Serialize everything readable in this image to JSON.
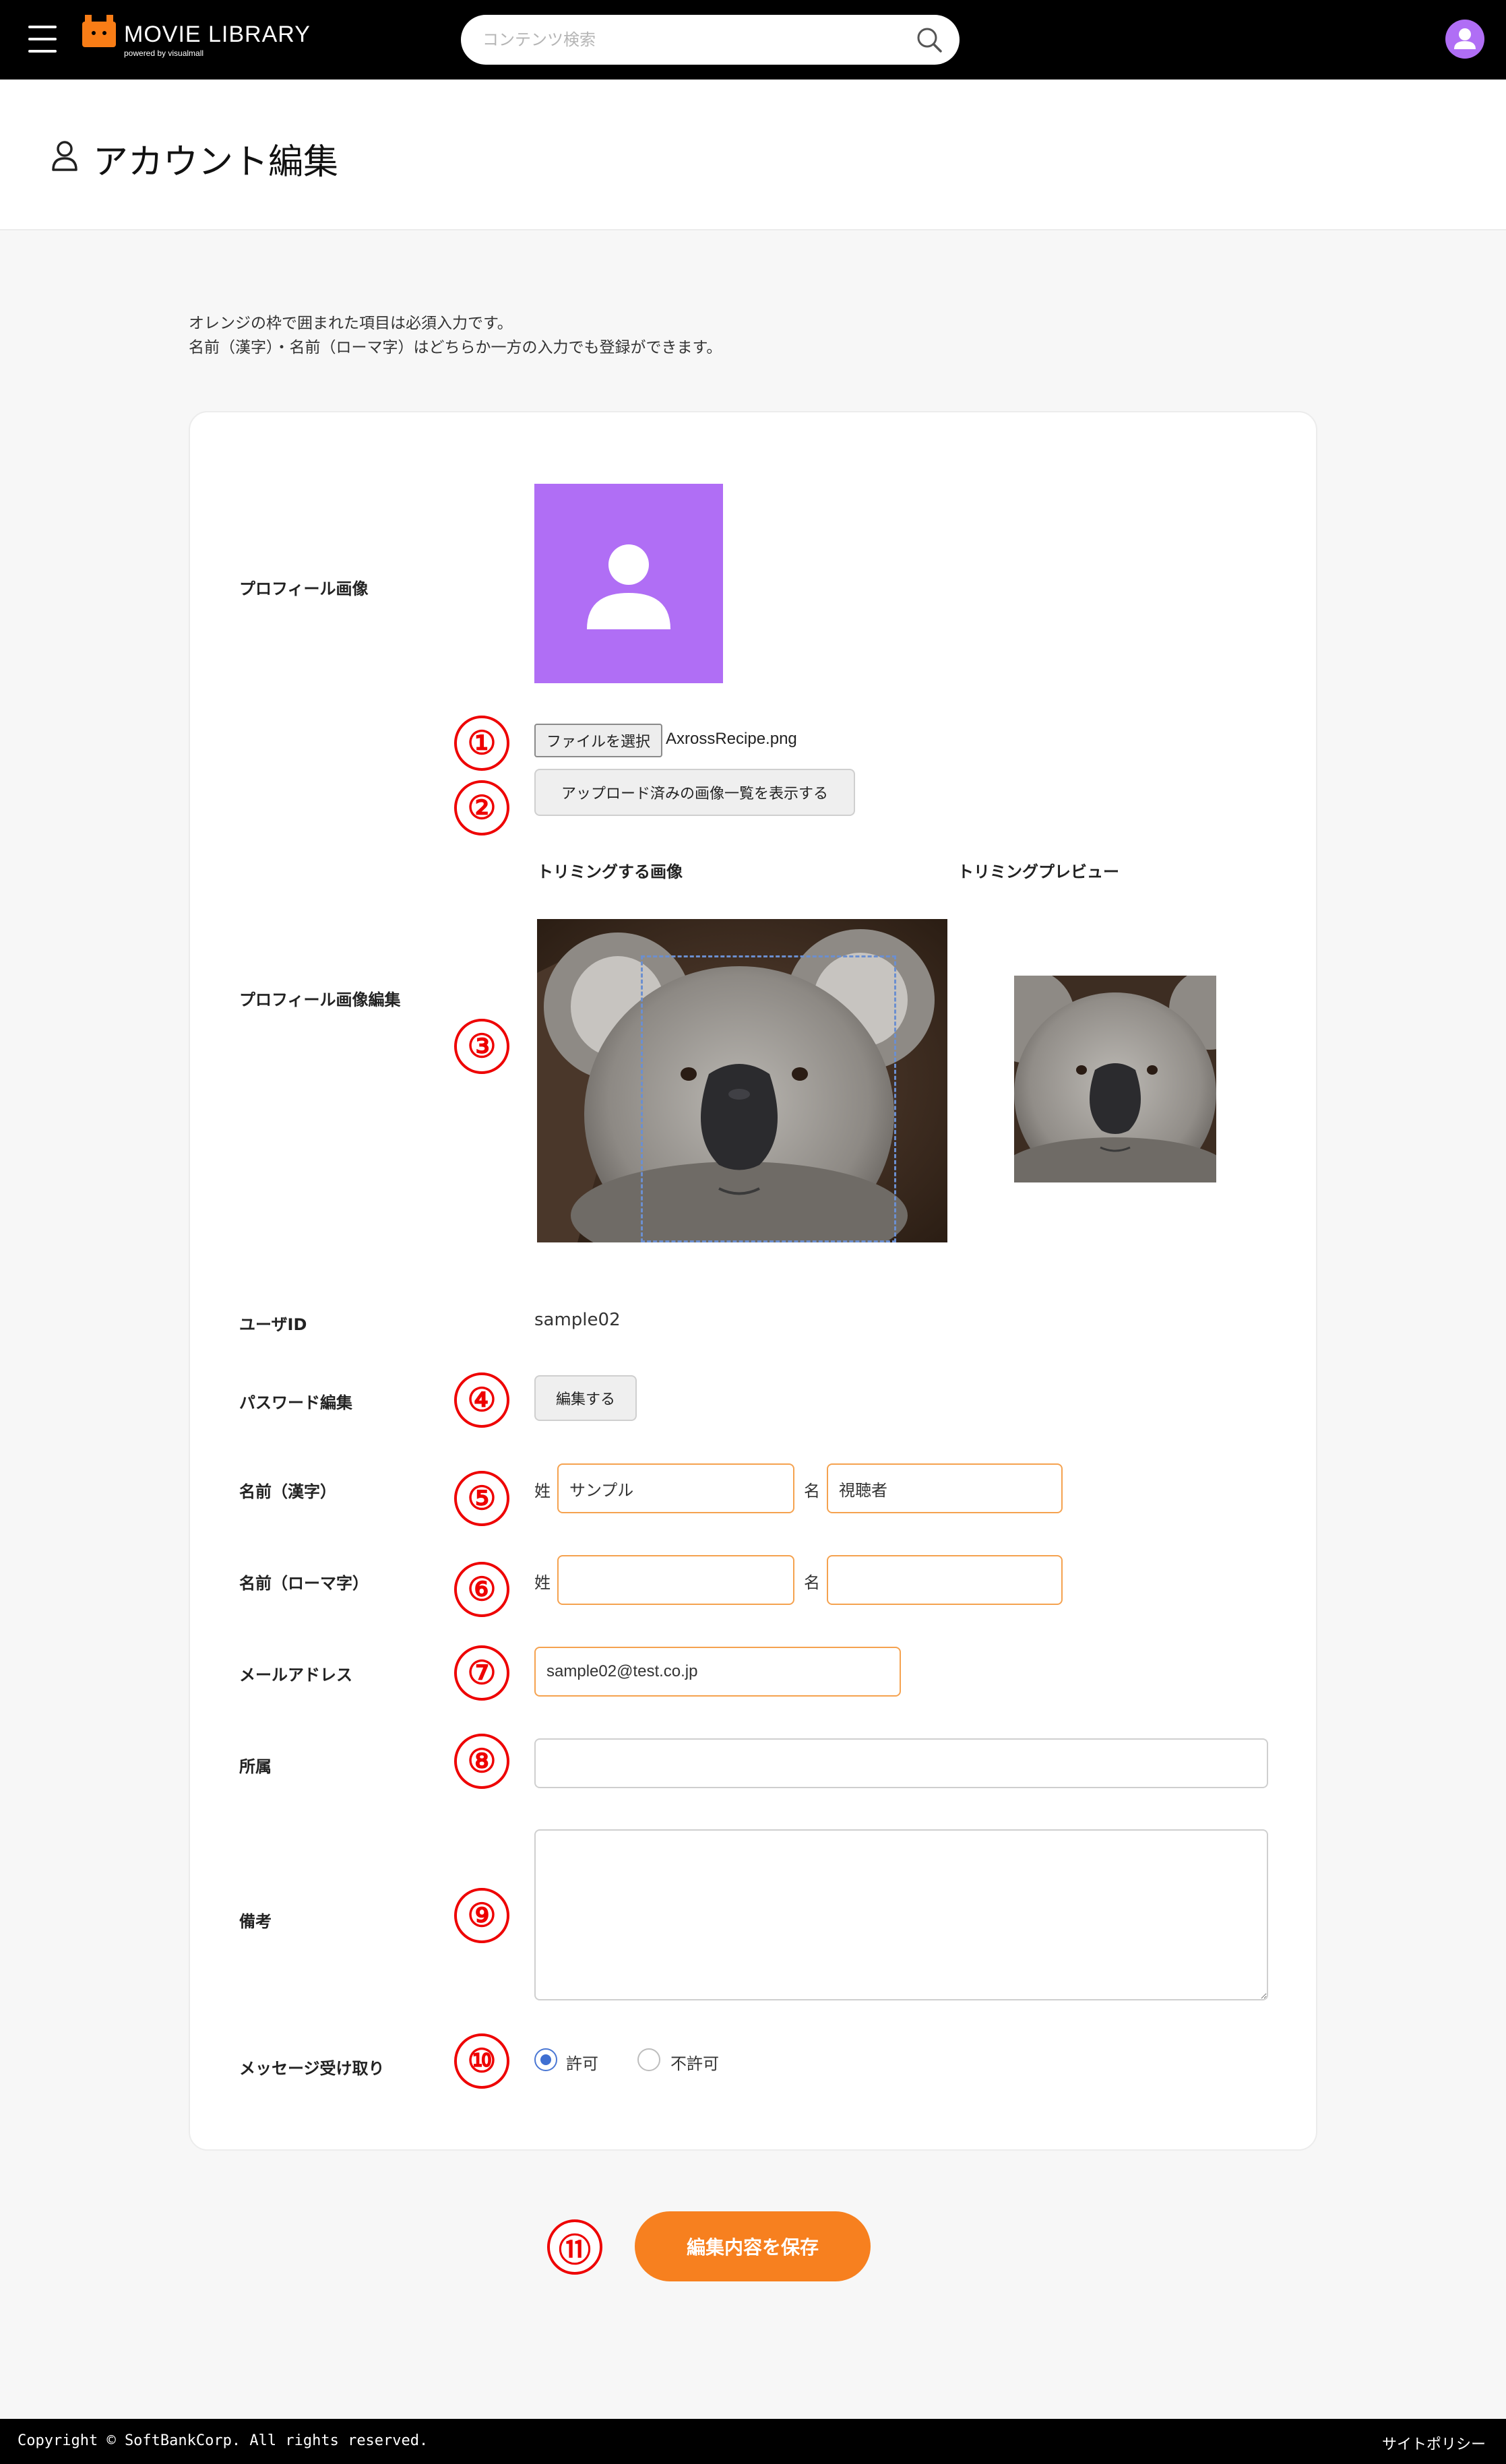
{
  "header": {
    "logo_title": "MOVIE LIBRARY",
    "logo_sub": "powered by visualmall",
    "search_placeholder": "コンテンツ検索"
  },
  "page": {
    "title": "アカウント編集",
    "notice_line1": "オレンジの枠で囲まれた項目は必須入力です。",
    "notice_line2": "名前（漢字）・名前（ローマ字）はどちらか一方の入力でも登録ができます。"
  },
  "form": {
    "profile_image_label": "プロフィール画像",
    "file_button": "ファイルを選択",
    "file_name": "AxrossRecipe.png",
    "uploaded_list_button": "アップロード済みの画像一覧を表示する",
    "profile_edit_label": "プロフィール画像編集",
    "trim_source_label": "トリミングする画像",
    "trim_preview_label": "トリミングプレビュー",
    "user_id_label": "ユーザID",
    "user_id_value": "sample02",
    "password_label": "パスワード編集",
    "password_button": "編集する",
    "name_kanji_label": "名前（漢字）",
    "name_roman_label": "名前（ローマ字）",
    "last_name_prefix": "姓",
    "first_name_prefix": "名",
    "kanji_last": "サンプル",
    "kanji_first": "視聴者",
    "roman_last": "",
    "roman_first": "",
    "email_label": "メールアドレス",
    "email_value": "sample02@test.co.jp",
    "affiliation_label": "所属",
    "affiliation_value": "",
    "remarks_label": "備考",
    "remarks_value": "",
    "message_label": "メッセージ受け取り",
    "allow_label": "許可",
    "deny_label": "不許可",
    "message_selected": "許可",
    "save_button": "編集内容を保存"
  },
  "callouts": [
    "①",
    "②",
    "③",
    "④",
    "⑤",
    "⑥",
    "⑦",
    "⑧",
    "⑨",
    "⑩",
    "⑪"
  ],
  "footer": {
    "copyright": "Copyright © SoftBankCorp. All rights reserved.",
    "site_policy": "サイトポリシー"
  },
  "colors": {
    "accent_orange": "#f7801f",
    "avatar_purple": "#b06ef5",
    "required_border": "#f5a24f",
    "callout_red": "#e00000"
  }
}
